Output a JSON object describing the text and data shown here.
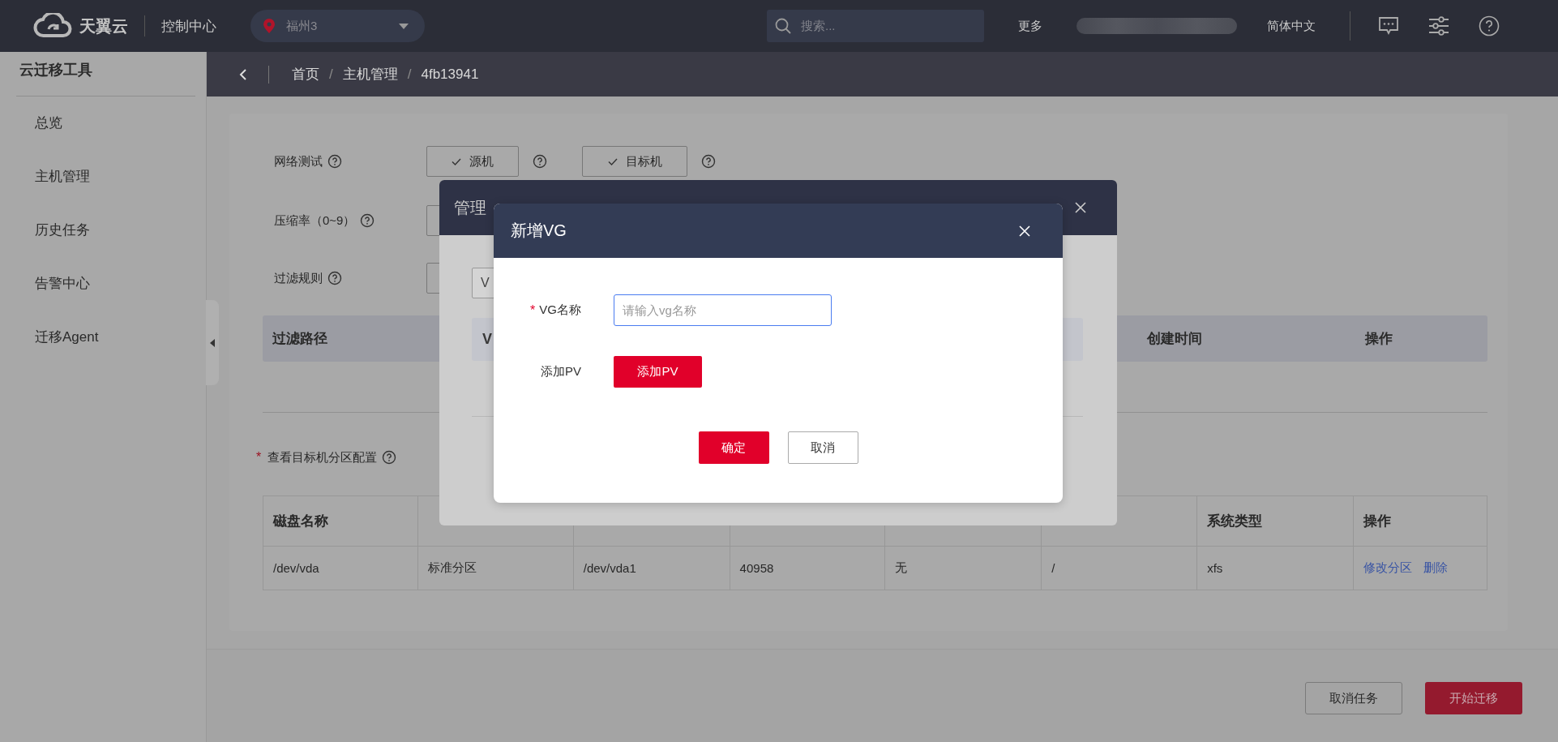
{
  "topbar": {
    "brand": "天翼云",
    "console": "控制中心",
    "region": "福州3",
    "search": {
      "placeholder": "搜索..."
    },
    "more": "更多",
    "language": "简体中文"
  },
  "breadcrumb": [
    {
      "kind": "link",
      "text": "首页"
    },
    {
      "kind": "separator",
      "text": "/"
    },
    {
      "kind": "link",
      "text": "主机管理"
    },
    {
      "kind": "separator",
      "text": "/"
    },
    {
      "kind": "current",
      "text": "4fb13941"
    }
  ],
  "sidebar": {
    "title": "云迁移工具",
    "items": [
      "总览",
      "主机管理",
      "历史任务",
      "告警中心",
      "迁移Agent"
    ]
  },
  "form": [
    {
      "kind": "buttons",
      "label": "网络测试",
      "buttons": [
        "源机",
        "目标机"
      ]
    },
    {
      "kind": "field",
      "label": "压缩率（0~9）"
    },
    {
      "kind": "field",
      "label": "过滤规则"
    }
  ],
  "filter_table": {
    "column_1": "过滤路径",
    "column_3": "创建时间",
    "column_4": "操作"
  },
  "partition": {
    "label": "查看目标机分区配置",
    "required_mark": "*",
    "table": {
      "header": {
        "column_1": "磁盘名称",
        "column_7": "系统类型",
        "column_8": "操作"
      },
      "rows": [
        {
          "cells": [
            "/dev/vda",
            "标准分区",
            "/dev/vda1",
            "40958",
            "无",
            "/",
            "xfs"
          ],
          "actions": [
            "修改分区",
            "删除"
          ]
        }
      ]
    }
  },
  "footer_buttons": [
    {
      "label": "取消任务",
      "kind": "secondary"
    },
    {
      "label": "开始迁移",
      "kind": "primary"
    }
  ],
  "lvm_modal": {
    "title": "管理",
    "select_value": "V",
    "table_column": "V"
  },
  "vg_dialog": {
    "title": "新增VG",
    "fields": [
      {
        "kind": "input",
        "label": "VG名称",
        "required_mark": "*",
        "placeholder": "请输入vg名称"
      },
      {
        "kind": "button",
        "label": "添加PV",
        "button": "添加PV"
      }
    ],
    "buttons": [
      {
        "label": "确定",
        "kind": "primary"
      },
      {
        "label": "取消",
        "kind": "secondary"
      }
    ]
  }
}
